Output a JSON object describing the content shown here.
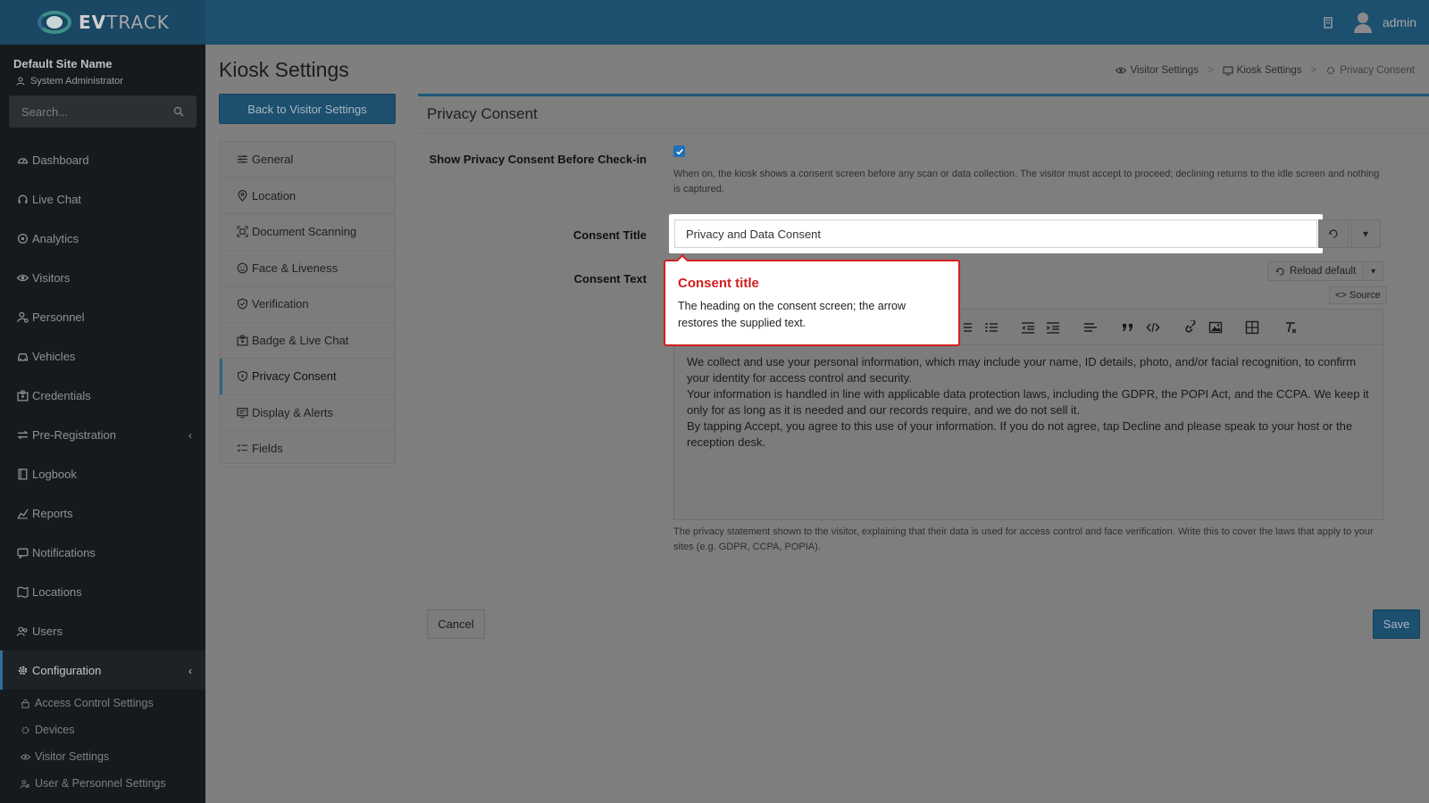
{
  "brand": {
    "name_bold": "EV",
    "name_rest": "TRACK"
  },
  "header": {
    "username": "admin"
  },
  "sidebar": {
    "site_name": "Default Site Name",
    "role": "System Administrator",
    "search_placeholder": "Search...",
    "items": [
      {
        "label": "Dashboard",
        "icon": "dashboard-icon"
      },
      {
        "label": "Live Chat",
        "icon": "headset-icon"
      },
      {
        "label": "Analytics",
        "icon": "target-icon"
      },
      {
        "label": "Visitors",
        "icon": "eye-icon"
      },
      {
        "label": "Personnel",
        "icon": "user-cog-icon"
      },
      {
        "label": "Vehicles",
        "icon": "car-icon"
      },
      {
        "label": "Credentials",
        "icon": "id-badge-icon"
      },
      {
        "label": "Pre-Registration",
        "icon": "exchange-icon"
      },
      {
        "label": "Logbook",
        "icon": "book-icon"
      },
      {
        "label": "Reports",
        "icon": "chart-icon"
      },
      {
        "label": "Notifications",
        "icon": "bell-icon"
      },
      {
        "label": "Locations",
        "icon": "map-icon"
      },
      {
        "label": "Users",
        "icon": "users-icon"
      },
      {
        "label": "Configuration",
        "icon": "gear-icon"
      }
    ],
    "sub_items": [
      {
        "label": "Access Control Settings",
        "icon": "lock-icon"
      },
      {
        "label": "Devices",
        "icon": "gear-icon"
      },
      {
        "label": "Visitor Settings",
        "icon": "eye-icon"
      },
      {
        "label": "User & Personnel Settings",
        "icon": "users-icon"
      }
    ]
  },
  "page": {
    "title": "Kiosk Settings",
    "back_label": "Back to Visitor Settings",
    "breadcrumb": [
      "Visitor Settings",
      "Kiosk Settings",
      "Privacy Consent"
    ]
  },
  "settings_menu": [
    {
      "label": "General",
      "icon": "sliders-icon"
    },
    {
      "label": "Location",
      "icon": "map-pin-icon"
    },
    {
      "label": "Document Scanning",
      "icon": "scan-icon"
    },
    {
      "label": "Face & Liveness",
      "icon": "face-icon"
    },
    {
      "label": "Verification",
      "icon": "shield-check-icon"
    },
    {
      "label": "Badge & Live Chat",
      "icon": "badge-icon"
    },
    {
      "label": "Privacy Consent",
      "icon": "shield-icon"
    },
    {
      "label": "Display & Alerts",
      "icon": "display-icon"
    },
    {
      "label": "Fields",
      "icon": "checklist-icon"
    }
  ],
  "panel": {
    "title": "Privacy Consent",
    "show_consent_label": "Show Privacy Consent Before Check-in",
    "show_consent_checked": true,
    "show_consent_help": "When on, the kiosk shows a consent screen before any scan or data collection. The visitor must accept to proceed; declining returns to the idle screen and nothing is captured.",
    "consent_title_label": "Consent Title",
    "consent_title_value": "Privacy and Data Consent",
    "consent_text_label": "Consent Text",
    "reload_default_label": "Reload default",
    "source_label": "<> Source",
    "consent_text_paragraphs": [
      "We collect and use your personal information, which may include your name, ID details, photo, and/or facial recognition, to confirm your identity for access control and security.",
      "Your information is handled in line with applicable data protection laws, including the GDPR, the POPI Act, and the CCPA. We keep it only for as long as it is needed and our records require, and we do not sell it.",
      "By tapping Accept, you agree to this use of your information. If you do not agree, tap Decline and please speak to your host or the reception desk."
    ],
    "consent_text_help": "The privacy statement shown to the visitor, explaining that their data is used for access control and face verification. Write this to cover the laws that apply to your sites (e.g. GDPR, CCPA, POPIA)."
  },
  "footer": {
    "cancel_label": "Cancel",
    "save_label": "Save"
  },
  "popover": {
    "title": "Consent title",
    "text": "The heading on the consent screen; the arrow restores the supplied text."
  },
  "colors": {
    "accent": "#1d4f6f",
    "highlight": "#d41d1d",
    "sidebar": "#161a1d"
  }
}
